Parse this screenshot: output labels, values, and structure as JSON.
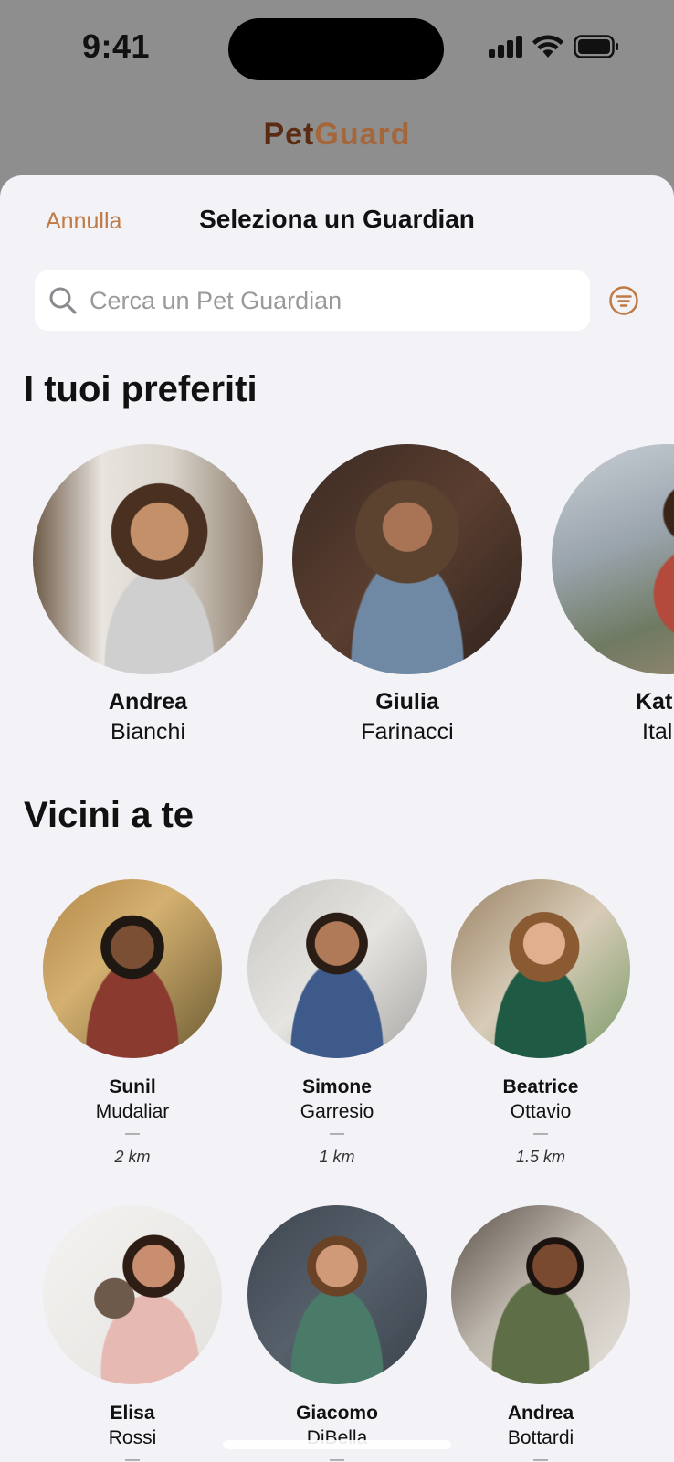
{
  "status_bar": {
    "time": "9:41"
  },
  "app": {
    "brand_part1": "Pet",
    "brand_part2": "Guard"
  },
  "sheet": {
    "cancel_label": "Annulla",
    "title": "Seleziona un Guardian"
  },
  "search": {
    "placeholder": "Cerca un Pet Guardian",
    "value": ""
  },
  "favorites": {
    "title": "I tuoi preferiti",
    "items": [
      {
        "first_name": "Andrea",
        "last_name": "Bianchi"
      },
      {
        "first_name": "Giulia",
        "last_name": "Farinacci"
      },
      {
        "first_name": "Kat",
        "last_name": "Itali"
      }
    ]
  },
  "nearby": {
    "title": "Vicini a te",
    "items": [
      {
        "first_name": "Sunil",
        "last_name": "Mudaliar",
        "separator": "—",
        "distance": "2 km"
      },
      {
        "first_name": "Simone",
        "last_name": "Garresio",
        "separator": "—",
        "distance": "1 km"
      },
      {
        "first_name": "Beatrice",
        "last_name": "Ottavio",
        "separator": "—",
        "distance": "1.5 km"
      },
      {
        "first_name": "Elisa",
        "last_name": "Rossi",
        "separator": "—",
        "distance": ""
      },
      {
        "first_name": "Giacomo",
        "last_name": "DiBella",
        "separator": "—",
        "distance": ""
      },
      {
        "first_name": "Andrea",
        "last_name": "Bottardi",
        "separator": "—",
        "distance": ""
      }
    ]
  },
  "colors": {
    "accent": "#c07a45",
    "brand_dark": "#5a2b12",
    "brand_light": "#a5663a",
    "sheet_background": "#f2f2f7",
    "backdrop": "#8e8e8e"
  },
  "icons": {
    "status": [
      "signal-icon",
      "wifi-icon",
      "battery-icon"
    ],
    "search": "search-icon",
    "filter": "filter-icon"
  }
}
